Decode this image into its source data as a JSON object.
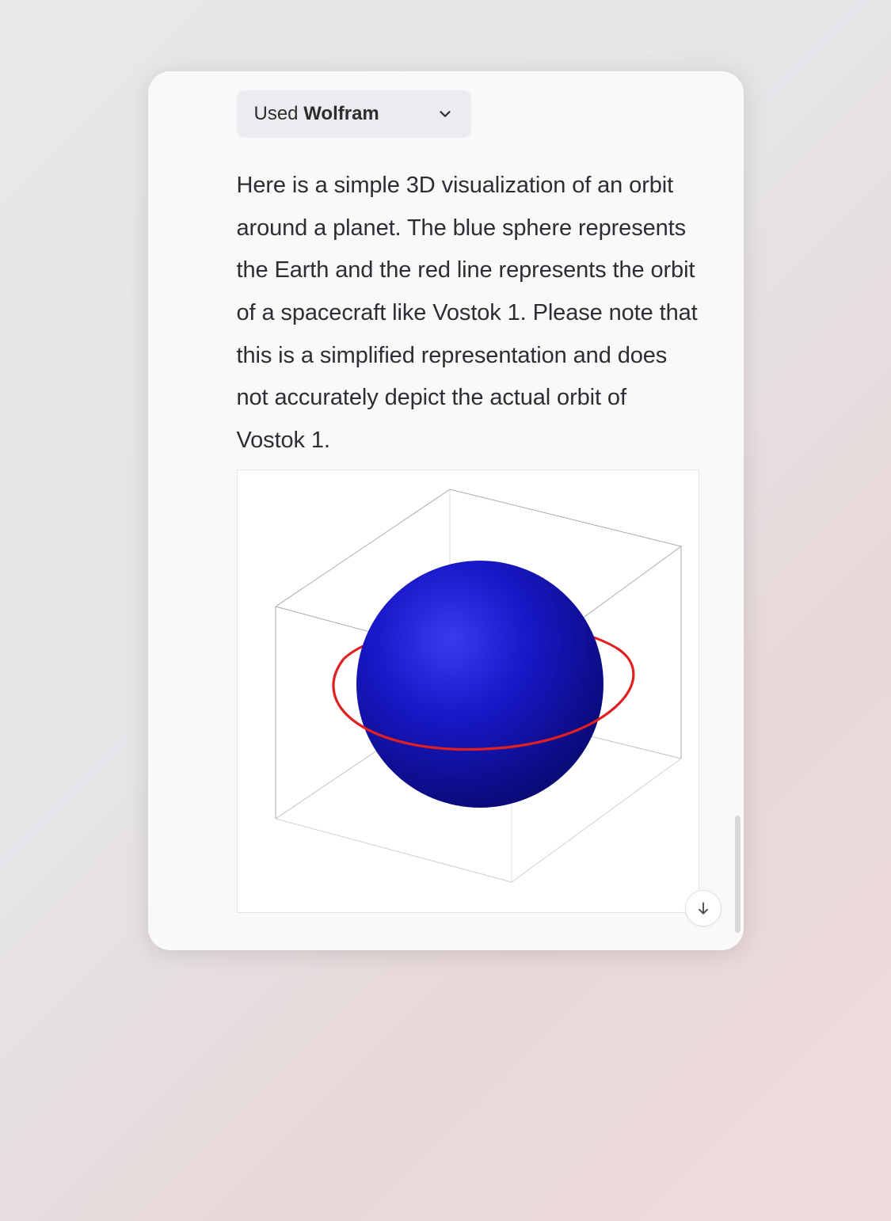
{
  "tool_chip": {
    "used_text": "Used ",
    "tool_name": "Wolfram"
  },
  "message_body": "Here is a simple 3D visualization of an orbit around a planet. The blue sphere represents the Earth and the red line represents the orbit of a spacecraft like Vostok 1. Please note that this is a simplified representation and does not accurately depict the actual orbit of Vostok 1.",
  "plot": {
    "description": "3D box wireframe containing a blue sphere (Earth) with a red elliptical orbit ring around its equator."
  }
}
